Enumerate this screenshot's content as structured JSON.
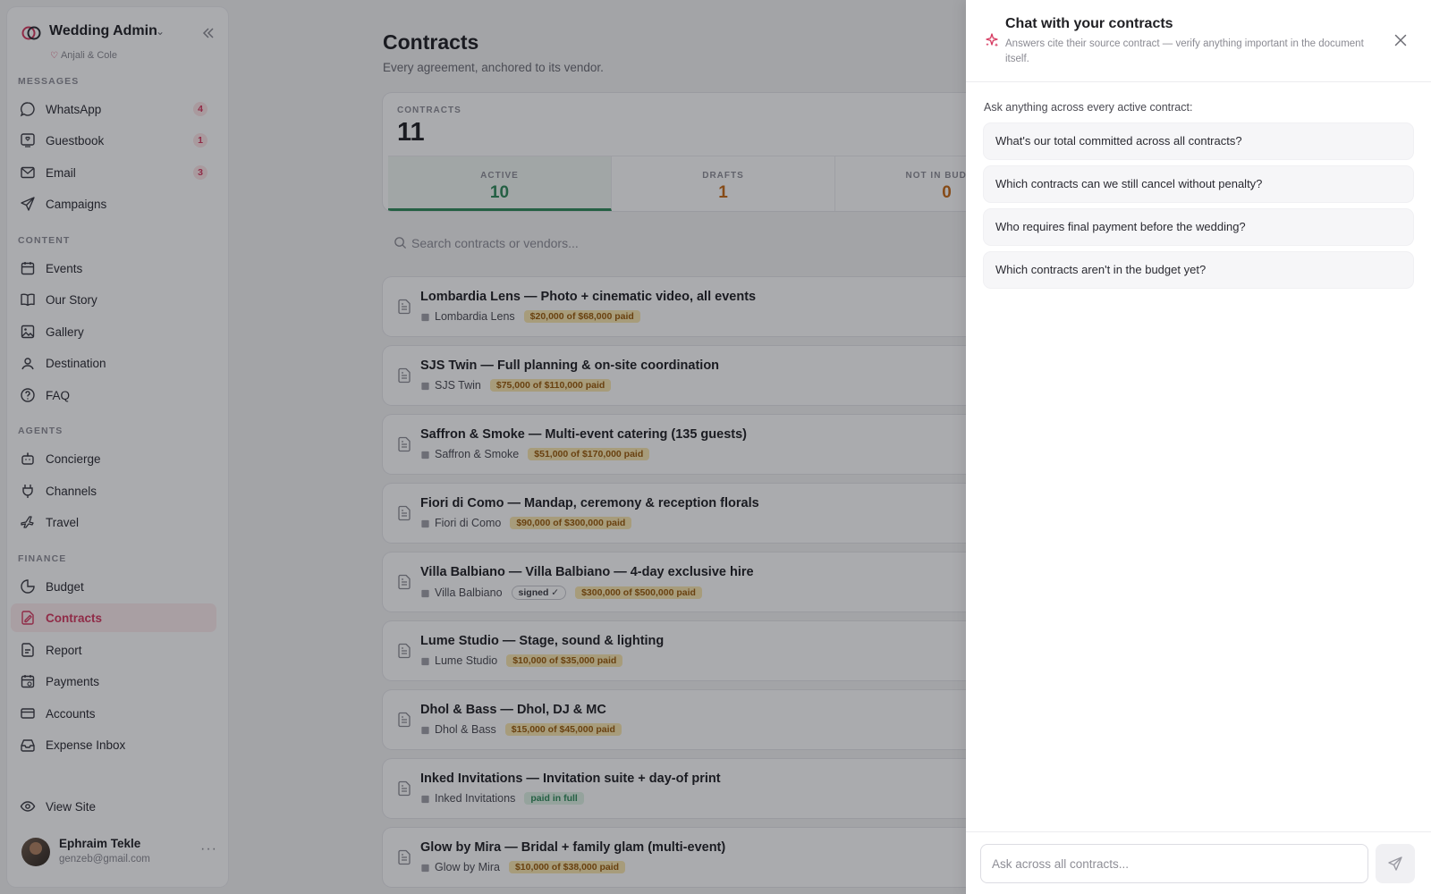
{
  "sidebar": {
    "brand": {
      "title": "Wedding Admin",
      "couple": "Anjali & Cole"
    },
    "sections": {
      "messages": "MESSAGES",
      "content": "CONTENT",
      "agents": "AGENTS",
      "finance": "FINANCE"
    },
    "items": {
      "whatsapp": {
        "label": "WhatsApp",
        "badge": "4"
      },
      "guestbook": {
        "label": "Guestbook",
        "badge": "1"
      },
      "email": {
        "label": "Email",
        "badge": "3"
      },
      "campaigns": {
        "label": "Campaigns"
      },
      "events": {
        "label": "Events"
      },
      "our_story": {
        "label": "Our Story"
      },
      "gallery": {
        "label": "Gallery"
      },
      "destination": {
        "label": "Destination"
      },
      "faq": {
        "label": "FAQ"
      },
      "concierge": {
        "label": "Concierge"
      },
      "channels": {
        "label": "Channels"
      },
      "travel": {
        "label": "Travel"
      },
      "budget": {
        "label": "Budget"
      },
      "contracts": {
        "label": "Contracts",
        "active": true
      },
      "report": {
        "label": "Report"
      },
      "payments": {
        "label": "Payments"
      },
      "accounts": {
        "label": "Accounts"
      },
      "expense_inbox": {
        "label": "Expense Inbox"
      },
      "view_site": {
        "label": "View Site"
      }
    },
    "user": {
      "name": "Ephraim Tekle",
      "email": "genzeb@gmail.com"
    }
  },
  "main": {
    "title": "Contracts",
    "subtitle": "Every agreement, anchored to its vendor.",
    "stats": {
      "total_label": "CONTRACTS",
      "total_value": "11",
      "cells": [
        {
          "label": "ACTIVE",
          "value": "10"
        },
        {
          "label": "DRAFTS",
          "value": "1"
        },
        {
          "label": "NOT IN BUDGET",
          "value": "0"
        }
      ]
    },
    "search": {
      "placeholder": "Search contracts or vendors..."
    },
    "contracts": [
      {
        "title": "Lombardia Lens — Photo + cinematic video, all events",
        "vendor": "Lombardia Lens",
        "paid": "$20,000 of $68,000 paid"
      },
      {
        "title": "SJS Twin — Full planning & on-site coordination",
        "vendor": "SJS Twin",
        "paid": "$75,000 of $110,000 paid"
      },
      {
        "title": "Saffron & Smoke — Multi-event catering (135 guests)",
        "vendor": "Saffron & Smoke",
        "paid": "$51,000 of $170,000 paid"
      },
      {
        "title": "Fiori di Como — Mandap, ceremony & reception florals",
        "vendor": "Fiori di Como",
        "paid": "$90,000 of $300,000 paid"
      },
      {
        "title": "Villa Balbiano — Villa Balbiano — 4-day exclusive hire",
        "vendor": "Villa Balbiano",
        "signed": "signed ✓",
        "paid": "$300,000 of $500,000 paid"
      },
      {
        "title": "Lume Studio — Stage, sound & lighting",
        "vendor": "Lume Studio",
        "paid": "$10,000 of $35,000 paid"
      },
      {
        "title": "Dhol & Bass — Dhol, DJ & MC",
        "vendor": "Dhol & Bass",
        "paid": "$15,000 of $45,000 paid"
      },
      {
        "title": "Inked Invitations — Invitation suite + day-of print",
        "vendor": "Inked Invitations",
        "paid_full": "paid in full"
      },
      {
        "title": "Glow by Mira — Bridal + family glam (multi-event)",
        "vendor": "Glow by Mira",
        "paid": "$10,000 of $38,000 paid"
      }
    ]
  },
  "chat": {
    "title": "Chat with your contracts",
    "subtitle": "Answers cite their source contract — verify anything important in the document itself.",
    "prompt": "Ask anything across every active contract:",
    "suggestions": [
      "What's our total committed across all contracts?",
      "Which contracts can we still cancel without penalty?",
      "Who requires final payment before the wedding?",
      "Which contracts aren't in the budget yet?"
    ],
    "input_placeholder": "Ask across all contracts..."
  },
  "colors": {
    "accent": "#d6385f",
    "active_green": "#2f8a5a",
    "warning_orange": "#c76a15",
    "overlay": "rgba(20,22,30,0.36)"
  },
  "icons": {
    "brand": "rings-icon",
    "collapse": "double-chevron-left-icon",
    "chat_spark": "sparkles-icon",
    "close": "close-icon",
    "send": "send-icon",
    "search": "search-icon",
    "doc": "document-icon",
    "vendor": "building-icon"
  }
}
